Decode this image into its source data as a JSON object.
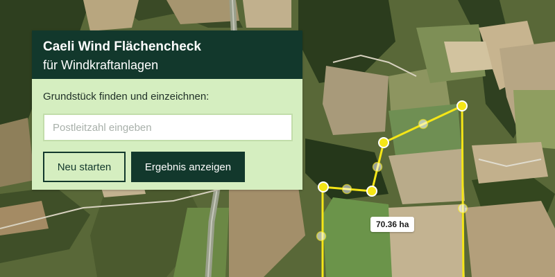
{
  "panel": {
    "title": "Caeli Wind Flächencheck",
    "subtitle": "für Windkraftanlagen",
    "prompt_label": "Grundstück finden und einzeichnen:",
    "search_placeholder": "Postleitzahl eingeben",
    "search_value": "",
    "restart_button": "Neu starten",
    "result_button": "Ergebnis anzeigen"
  },
  "map": {
    "area_label": "70.36 ha",
    "polygon_color": "#f5e617",
    "vertex_icon": "polygon-vertex-handle",
    "midpoint_icon": "polygon-midpoint-handle"
  },
  "colors": {
    "panel_header": "#12382c",
    "panel_body": "#d5eec0",
    "button_filled": "#12382c"
  }
}
